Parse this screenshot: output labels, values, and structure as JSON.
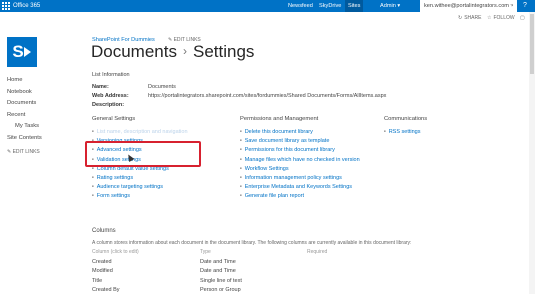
{
  "suite_bar": {
    "brand": "Office 365",
    "nav": [
      {
        "label": "Newsfeed"
      },
      {
        "label": "SkyDrive"
      },
      {
        "label": "Sites"
      },
      {
        "label": "Admin ▾"
      }
    ],
    "user": "ken.withee@portalintegrators.com ▾",
    "icons": [
      "waffle-icon",
      "gear-icon",
      "help-icon"
    ]
  },
  "actions": {
    "share": "SHARE",
    "follow": "FOLLOW",
    "edit_links_top": "EDIT LINKS"
  },
  "header": {
    "site_name": "SharePoint For Dummies",
    "title_parent": "Documents",
    "title_separator": "›",
    "title_current": "Settings"
  },
  "left_nav": {
    "items": [
      {
        "label": "Home"
      },
      {
        "label": "Notebook"
      },
      {
        "label": "Documents"
      },
      {
        "label": "Recent"
      },
      {
        "label": "My Tasks"
      },
      {
        "label": "Site Contents"
      }
    ],
    "edit_links": "EDIT LINKS"
  },
  "list_info": {
    "heading": "List Information",
    "fields": [
      {
        "key": "Name:",
        "value": "Documents"
      },
      {
        "key": "Web Address:",
        "value": "https://portalintegrators.sharepoint.com/sites/fordummies/Shared Documents/Forms/AllItems.aspx"
      },
      {
        "key": "Description:",
        "value": ""
      }
    ]
  },
  "settings": {
    "general": {
      "heading": "General Settings",
      "items": [
        "List name, description and navigation",
        "Versioning settings",
        "Advanced settings",
        "Validation settings",
        "Column default value settings",
        "Rating settings",
        "Audience targeting settings",
        "Form settings"
      ]
    },
    "permissions": {
      "heading": "Permissions and Management",
      "items": [
        "Delete this document library",
        "Save document library as template",
        "Permissions for this document library",
        "Manage files which have no checked in version",
        "Workflow Settings",
        "Information management policy settings",
        "Enterprise Metadata and Keywords Settings",
        "Generate file plan report"
      ]
    },
    "communications": {
      "heading": "Communications",
      "items": [
        "RSS settings"
      ]
    }
  },
  "columns": {
    "heading": "Columns",
    "description": "A column stores information about each document in the document library. The following columns are currently available in this document library:",
    "headers": [
      "Column (click to edit)",
      "Type",
      "Required"
    ],
    "rows": [
      [
        "Created",
        "Date and Time",
        ""
      ],
      [
        "Modified",
        "Date and Time",
        ""
      ],
      [
        "Title",
        "Single line of text",
        ""
      ],
      [
        "Created By",
        "Person or Group",
        ""
      ]
    ]
  },
  "colors": {
    "suite_bar": "#0072c6",
    "link": "#0072c6",
    "highlight": "#d7212f"
  }
}
